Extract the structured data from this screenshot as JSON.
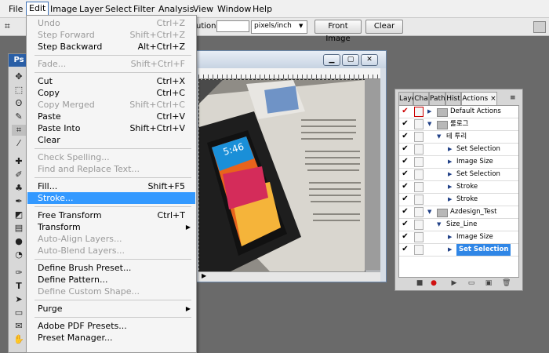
{
  "menubar": {
    "items": [
      "File",
      "Edit",
      "Image",
      "Layer",
      "Select",
      "Filter",
      "Analysis",
      "View",
      "Window",
      "Help"
    ],
    "active": "Edit"
  },
  "options": {
    "resolution_label": "ution:",
    "resolution_value": "",
    "unit": "pixels/inch",
    "front_image": "Front Image",
    "clear": "Clear"
  },
  "tools": {
    "app_badge": "Ps"
  },
  "edit_menu": {
    "undo": {
      "label": "Undo",
      "shortcut": "Ctrl+Z"
    },
    "step_forward": {
      "label": "Step Forward",
      "shortcut": "Shift+Ctrl+Z"
    },
    "step_backward": {
      "label": "Step Backward",
      "shortcut": "Alt+Ctrl+Z"
    },
    "fade": {
      "label": "Fade...",
      "shortcut": "Shift+Ctrl+F"
    },
    "cut": {
      "label": "Cut",
      "shortcut": "Ctrl+X"
    },
    "copy": {
      "label": "Copy",
      "shortcut": "Ctrl+C"
    },
    "copy_merged": {
      "label": "Copy Merged",
      "shortcut": "Shift+Ctrl+C"
    },
    "paste": {
      "label": "Paste",
      "shortcut": "Ctrl+V"
    },
    "paste_into": {
      "label": "Paste Into",
      "shortcut": "Shift+Ctrl+V"
    },
    "clear": {
      "label": "Clear"
    },
    "check_spelling": {
      "label": "Check Spelling..."
    },
    "find_replace": {
      "label": "Find and Replace Text..."
    },
    "fill": {
      "label": "Fill...",
      "shortcut": "Shift+F5"
    },
    "stroke": {
      "label": "Stroke..."
    },
    "free_transform": {
      "label": "Free Transform",
      "shortcut": "Ctrl+T"
    },
    "transform": {
      "label": "Transform"
    },
    "auto_align": {
      "label": "Auto-Align Layers..."
    },
    "auto_blend": {
      "label": "Auto-Blend Layers..."
    },
    "define_brush": {
      "label": "Define Brush Preset..."
    },
    "define_pattern": {
      "label": "Define Pattern..."
    },
    "define_shape": {
      "label": "Define Custom Shape..."
    },
    "purge": {
      "label": "Purge"
    },
    "pdf_presets": {
      "label": "Adobe PDF Presets..."
    },
    "preset_manager": {
      "label": "Preset Manager..."
    }
  },
  "actions_panel": {
    "tabs": [
      "Laye",
      "Cha",
      "Path",
      "Hist",
      "Actions"
    ],
    "rows": [
      {
        "label": "Default Actions"
      },
      {
        "label": "룰로그"
      },
      {
        "label": "테 투리"
      },
      {
        "label": "Set Selection"
      },
      {
        "label": "Image Size"
      },
      {
        "label": "Set Selection"
      },
      {
        "label": "Stroke"
      },
      {
        "label": "Stroke"
      },
      {
        "label": "Azdesign_Test"
      },
      {
        "label": "Size_Line"
      },
      {
        "label": "Image Size"
      },
      {
        "label": "Set Selection"
      }
    ]
  },
  "colors": {
    "menu_highlight": "#3399ff",
    "action_selected": "#2f86e6",
    "workspace": "#6a6a6a"
  }
}
